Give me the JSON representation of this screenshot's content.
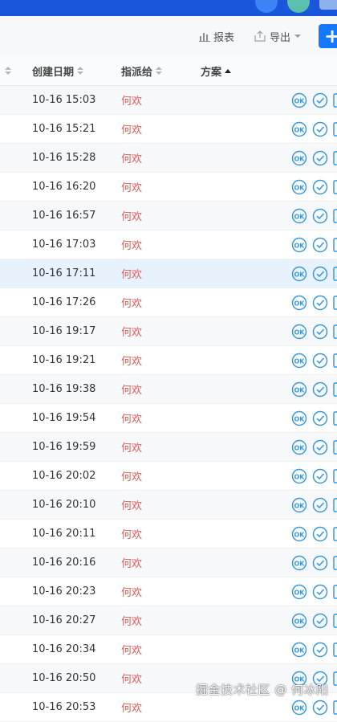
{
  "toolbar": {
    "report_label": "报表",
    "export_label": "导出",
    "add_label": "+"
  },
  "table": {
    "headers": {
      "created": "创建日期",
      "assignee": "指派给",
      "plan": "方案"
    },
    "rows": [
      {
        "date": "10-16 15:03",
        "assignee": "何欢"
      },
      {
        "date": "10-16 15:21",
        "assignee": "何欢"
      },
      {
        "date": "10-16 15:28",
        "assignee": "何欢"
      },
      {
        "date": "10-16 16:20",
        "assignee": "何欢"
      },
      {
        "date": "10-16 16:57",
        "assignee": "何欢"
      },
      {
        "date": "10-16 17:03",
        "assignee": "何欢"
      },
      {
        "date": "10-16 17:11",
        "assignee": "何欢"
      },
      {
        "date": "10-16 17:26",
        "assignee": "何欢"
      },
      {
        "date": "10-16 19:17",
        "assignee": "何欢"
      },
      {
        "date": "10-16 19:21",
        "assignee": "何欢"
      },
      {
        "date": "10-16 19:38",
        "assignee": "何欢"
      },
      {
        "date": "10-16 19:54",
        "assignee": "何欢"
      },
      {
        "date": "10-16 19:59",
        "assignee": "何欢"
      },
      {
        "date": "10-16 20:02",
        "assignee": "何欢"
      },
      {
        "date": "10-16 20:10",
        "assignee": "何欢"
      },
      {
        "date": "10-16 20:11",
        "assignee": "何欢"
      },
      {
        "date": "10-16 20:16",
        "assignee": "何欢"
      },
      {
        "date": "10-16 20:23",
        "assignee": "何欢"
      },
      {
        "date": "10-16 20:27",
        "assignee": "何欢"
      },
      {
        "date": "10-16 20:34",
        "assignee": "何欢"
      },
      {
        "date": "10-16 20:50",
        "assignee": "何欢"
      },
      {
        "date": "10-16 20:53",
        "assignee": "何欢"
      }
    ],
    "highlighted_row": 6,
    "action_icons": [
      "ok-icon",
      "check-circle-icon",
      "edit-icon"
    ]
  },
  "colors": {
    "accent": "#1677ff",
    "assignee": "#e35a5a",
    "icon": "#3a9ad9",
    "highlight_row": "#e8f2fd"
  },
  "watermark": "掘金技术社区 @ 何冰阳"
}
